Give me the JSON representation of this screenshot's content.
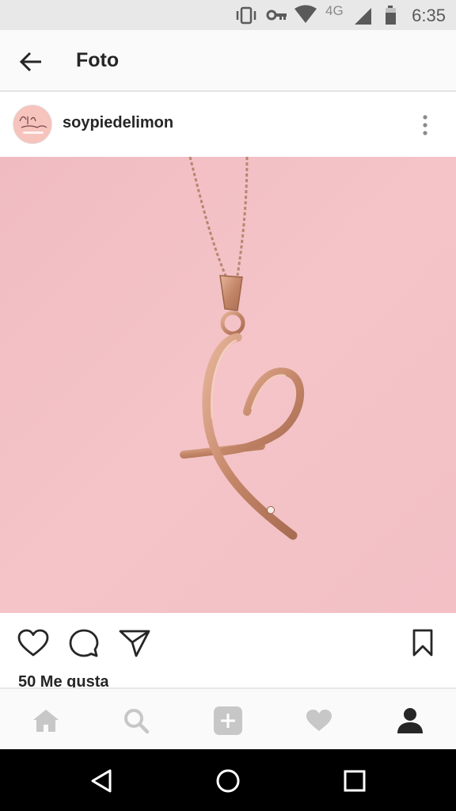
{
  "status_bar": {
    "network": "4G",
    "time": "6:35",
    "icons": [
      "vibrate-icon",
      "vpn-key-icon",
      "wifi-icon",
      "signal-icon",
      "battery-icon"
    ]
  },
  "app_bar": {
    "back_icon": "arrow-left-icon",
    "title": "Foto"
  },
  "post": {
    "avatar": "profile-avatar",
    "username": "soypiedelimon",
    "more_icon": "more-vertical-icon",
    "photo": "rose-gold-heart-cross-necklace-photo",
    "actions": [
      "heart-icon",
      "comment-icon",
      "send-icon",
      "bookmark-icon"
    ],
    "likes": "50 Me gusta"
  },
  "bottom_nav": {
    "items": [
      "home-icon",
      "search-icon",
      "add-icon",
      "activity-heart-icon",
      "profile-icon"
    ]
  },
  "system_nav": {
    "items": [
      "back-triangle-icon",
      "home-circle-icon",
      "recents-square-icon"
    ]
  },
  "colors": {
    "status_bar_bg": "#e8e8e8",
    "photo_bg": "#f2bfc4",
    "pendant": "#c98e72",
    "text": "#262626",
    "nav_inactive": "#c7c7c7"
  }
}
